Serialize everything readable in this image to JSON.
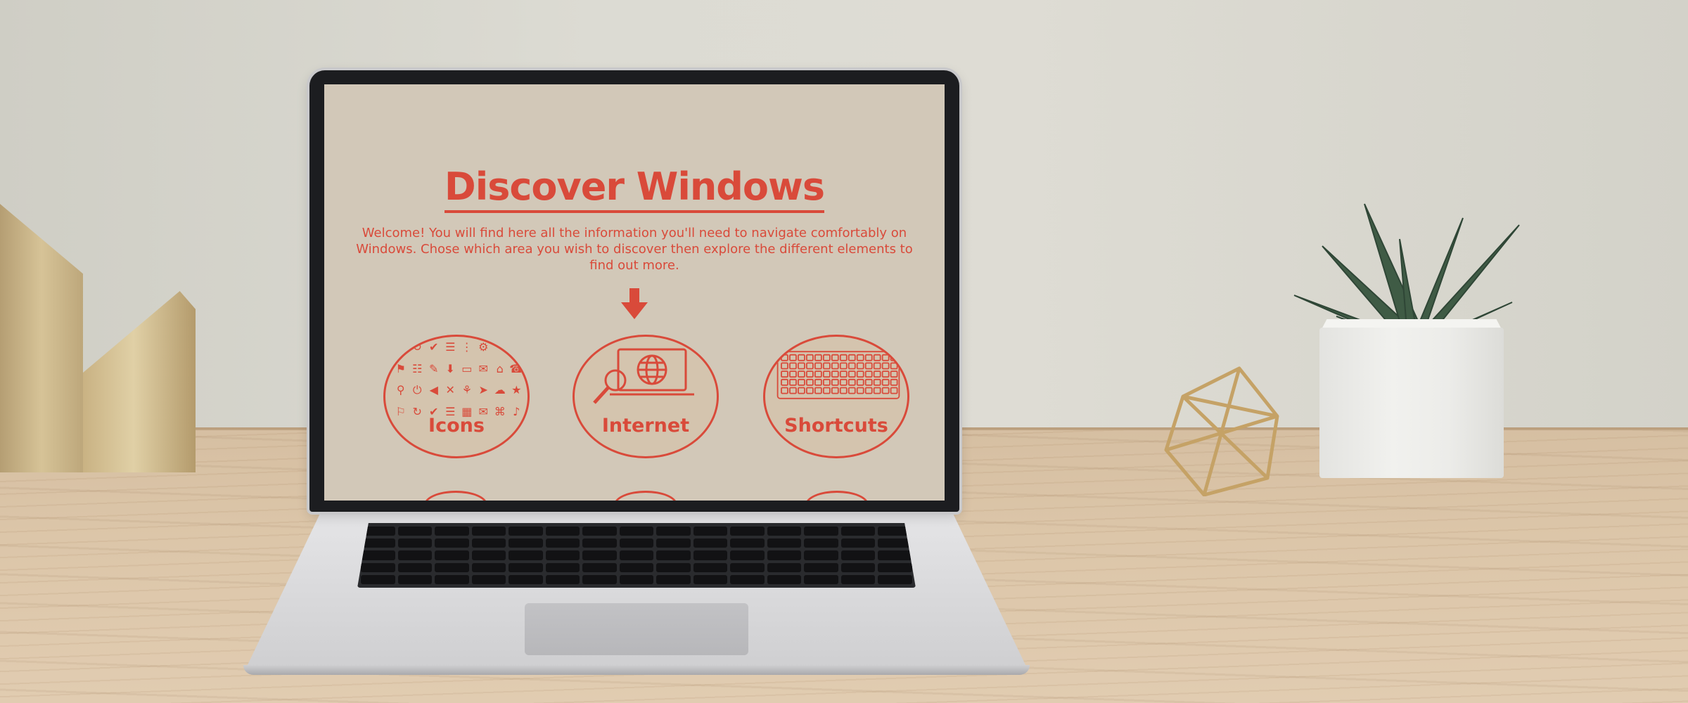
{
  "screen": {
    "title": "Discover Windows",
    "intro": "Welcome! You will find here all the information you'll need to navigate comfortably on Windows. Chose which area you wish to discover then explore the different elements to find out more.",
    "arrow_icon": "arrow-down-icon",
    "cards": [
      {
        "label": "Icons",
        "icon": "icon-collage-icon"
      },
      {
        "label": "Internet",
        "icon": "laptop-globe-search-icon"
      },
      {
        "label": "Shortcuts",
        "icon": "keyboard-icon"
      }
    ]
  },
  "colors": {
    "accent": "#d94a3a",
    "screen_background": "#d2c8b8",
    "card_fill": "#d4c4ae"
  }
}
